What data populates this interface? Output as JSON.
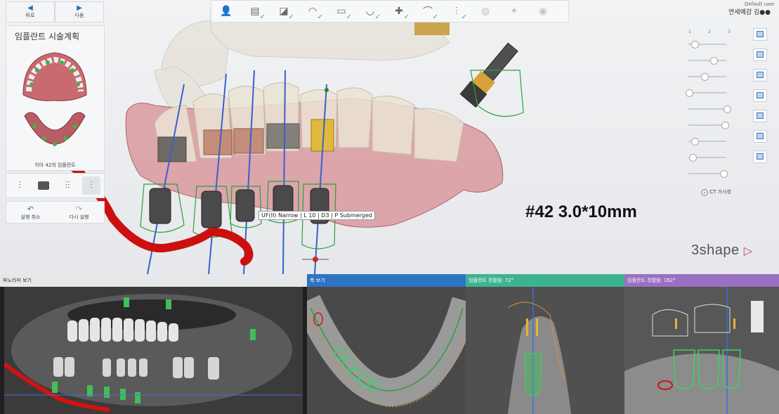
{
  "nav": {
    "back_label": "뒤로",
    "next_label": "다음"
  },
  "plan": {
    "title": "임플란트 시술계획",
    "tooth_caption": "치아 42의 임플란트"
  },
  "undo": {
    "undo_label": "실행 취소",
    "redo_label": "다시 실행"
  },
  "toolbar": {
    "steps": [
      {
        "icon": "patient-icon",
        "done": false
      },
      {
        "icon": "scan-data-icon",
        "done": true
      },
      {
        "icon": "scan-align-icon",
        "done": true
      },
      {
        "icon": "tooth-crown-icon",
        "done": true
      },
      {
        "icon": "ct-slice-icon",
        "done": true
      },
      {
        "icon": "arch-curve-icon",
        "done": true
      },
      {
        "icon": "nerve-icon",
        "done": true
      },
      {
        "icon": "bone-icon",
        "done": true
      },
      {
        "icon": "implant-icon",
        "done": true
      },
      {
        "icon": "guide-icon",
        "done": false
      },
      {
        "icon": "export-icon",
        "done": false
      },
      {
        "icon": "review-icon",
        "done": false
      }
    ]
  },
  "user": {
    "default_label": "Default user",
    "name": "연세예감 김●●"
  },
  "right_panel": {
    "columns": [
      "1",
      "2",
      "3"
    ],
    "ct_visible_label": "CT 가시성",
    "slider_levels": [
      0.15,
      0.65,
      0.4,
      0.0,
      1.0,
      0.95,
      0.15,
      0.1,
      0.9
    ]
  },
  "viewport": {
    "implant_label": "UF(II) Narrow | L 10 | D3 | P Submerged",
    "annotation": "#42  3.0*10mm",
    "logo": "3shape"
  },
  "panes": {
    "panorama": {
      "title": "파노라마 보기"
    },
    "axial": {
      "title": "축 보기"
    },
    "cross1": {
      "title": "임플란트 정렬됨: 72°"
    },
    "cross2": {
      "title": "임플란트 정렬됨: 162°"
    }
  },
  "colors": {
    "accent": "#2a6fb8",
    "check": "#3cb54a",
    "nerve": "#d20f0f",
    "guide_green": "#2d9e3a",
    "pane_panorama": "#e6e7e9",
    "pane_axial": "#2e74c5",
    "pane_cross1": "#3fb390",
    "pane_cross2": "#9a70c0"
  }
}
